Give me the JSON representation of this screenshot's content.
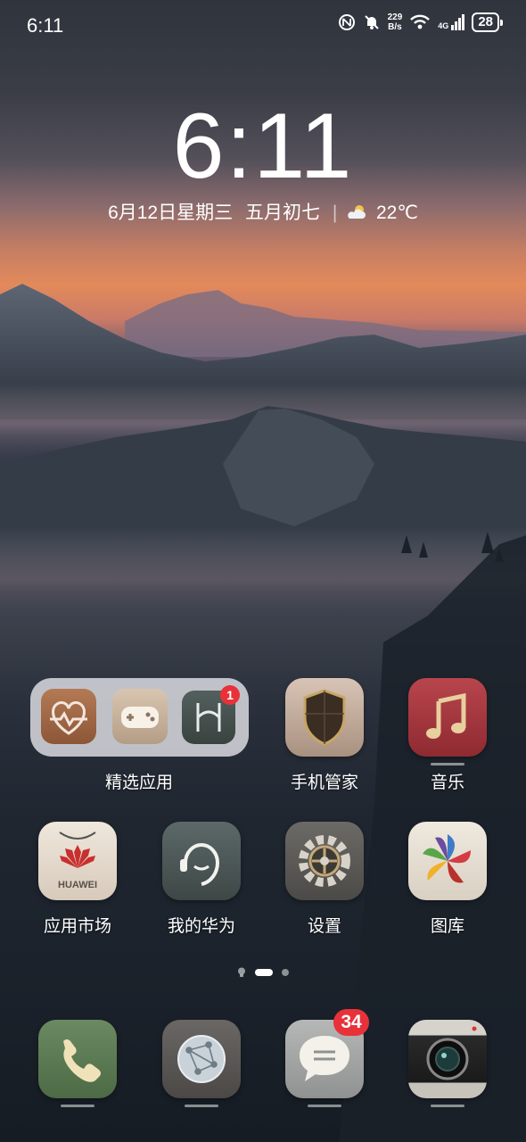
{
  "status_bar": {
    "time": "6:11",
    "net_speed_value": "229",
    "net_speed_unit": "B/s",
    "network": "4G",
    "battery": "28"
  },
  "lockclock": {
    "time": "6:11",
    "date": "6月12日星期三",
    "lunar": "五月初七",
    "weather_temp": "22℃",
    "weather_icon": "partly-cloudy-icon"
  },
  "folder": {
    "label": "精选应用",
    "badge": "1",
    "apps": [
      "health-icon",
      "game-center-icon",
      "huawei-app-icon"
    ]
  },
  "apps": [
    {
      "label": "手机管家",
      "icon": "shield-icon"
    },
    {
      "label": "音乐",
      "icon": "music-note-icon"
    },
    {
      "label": "应用市场",
      "icon": "huawei-appgallery-icon",
      "logo_text": "HUAWEI"
    },
    {
      "label": "我的华为",
      "icon": "headset-person-icon"
    },
    {
      "label": "设置",
      "icon": "gear-icon"
    },
    {
      "label": "图库",
      "icon": "gallery-pinwheel-icon"
    }
  ],
  "dock": [
    {
      "name": "phone",
      "icon": "phone-icon"
    },
    {
      "name": "browser",
      "icon": "globe-network-icon"
    },
    {
      "name": "messages",
      "icon": "message-icon",
      "badge": "34"
    },
    {
      "name": "camera",
      "icon": "camera-icon"
    }
  ],
  "page_indicator": {
    "pages": 3,
    "active": 2
  }
}
